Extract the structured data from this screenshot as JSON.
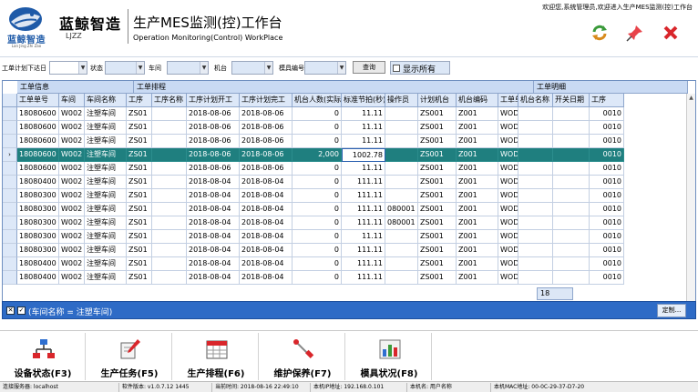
{
  "header": {
    "logo_cn": "蓝鲸智造",
    "logo_en": "Lan Jing Zhi Zao",
    "brand_cn": "蓝鲸智造",
    "brand_en": "LJZZ",
    "title_cn": "生产MES监测(控)工作台",
    "title_en": "Operation Monitoring(Control) WorkPlace",
    "top_status": "欢迎您,系统管理员,欢迎进入生产MES监测(控)工作台",
    "icons": [
      "refresh-icon",
      "pin-icon",
      "close-icon"
    ],
    "colors": {
      "brand": "#1e5aa8",
      "close": "#d9262b",
      "refresh": "#3a9a3a"
    }
  },
  "filters": {
    "f1_label": "工单计划下达日",
    "f2_label": "状态",
    "f3_label": "车间",
    "f4_label": "机台",
    "f5_label": "模具编号",
    "query_label": "查询",
    "show_all_label": "显示所有"
  },
  "grid": {
    "bands": [
      "工单信息",
      "工单排程",
      "工单明细"
    ],
    "columns": [
      "工单单号",
      "车间",
      "车间名称",
      "工序",
      "工序名称",
      "工序计划开工",
      "工序计划完工",
      "机台人数(实际)",
      "标准节拍(秒)",
      "操作员",
      "计划机台",
      "机台编码",
      "工单单号",
      "机台名称",
      "开关日期",
      "工序"
    ],
    "rows": [
      [
        "18080600",
        "W002",
        "注塑车间",
        "ZS01",
        "",
        "2018-08-06",
        "2018-08-06",
        "0",
        "11.11",
        "",
        "ZS001",
        "Z001",
        "WOD",
        "",
        "",
        "0010"
      ],
      [
        "18080600",
        "W002",
        "注塑车间",
        "ZS01",
        "",
        "2018-08-06",
        "2018-08-06",
        "0",
        "11.11",
        "",
        "ZS001",
        "Z001",
        "WOD",
        "",
        "",
        "0010"
      ],
      [
        "18080600",
        "W002",
        "注塑车间",
        "ZS01",
        "",
        "2018-08-06",
        "2018-08-06",
        "0",
        "11.11",
        "",
        "ZS001",
        "Z001",
        "WOD",
        "",
        "",
        "0010"
      ],
      [
        "18080600",
        "W002",
        "注塑车间",
        "ZS01",
        "",
        "2018-08-06",
        "2018-08-06",
        "2,000",
        "1002.78",
        "",
        "ZS001",
        "Z001",
        "WOD",
        "",
        "",
        "0010"
      ],
      [
        "18080600",
        "W002",
        "注塑车间",
        "ZS01",
        "",
        "2018-08-06",
        "2018-08-06",
        "0",
        "11.11",
        "",
        "ZS001",
        "Z001",
        "WOD",
        "",
        "",
        "0010"
      ],
      [
        "18080400",
        "W002",
        "注塑车间",
        "ZS01",
        "",
        "2018-08-04",
        "2018-08-04",
        "0",
        "111.11",
        "",
        "ZS001",
        "Z001",
        "WOD",
        "",
        "",
        "0010"
      ],
      [
        "18080300",
        "W002",
        "注塑车间",
        "ZS01",
        "",
        "2018-08-04",
        "2018-08-04",
        "0",
        "111.11",
        "",
        "ZS001",
        "Z001",
        "WOD",
        "",
        "",
        "0010"
      ],
      [
        "18080300",
        "W002",
        "注塑车间",
        "ZS01",
        "",
        "2018-08-04",
        "2018-08-04",
        "0",
        "111.11",
        "080001",
        "ZS001",
        "Z001",
        "WOD",
        "",
        "",
        "0010"
      ],
      [
        "18080300",
        "W002",
        "注塑车间",
        "ZS01",
        "",
        "2018-08-04",
        "2018-08-04",
        "0",
        "111.11",
        "080001",
        "ZS001",
        "Z001",
        "WOD",
        "",
        "",
        "0010"
      ],
      [
        "18080300",
        "W002",
        "注塑车间",
        "ZS01",
        "",
        "2018-08-04",
        "2018-08-04",
        "0",
        "11.11",
        "",
        "ZS001",
        "Z001",
        "WOD",
        "",
        "",
        "0010"
      ],
      [
        "18080300",
        "W002",
        "注塑车间",
        "ZS01",
        "",
        "2018-08-04",
        "2018-08-04",
        "0",
        "111.11",
        "",
        "ZS001",
        "Z001",
        "WOD",
        "",
        "",
        "0010"
      ],
      [
        "18080400",
        "W002",
        "注塑车间",
        "ZS01",
        "",
        "2018-08-04",
        "2018-08-04",
        "0",
        "111.11",
        "",
        "ZS001",
        "Z001",
        "WOD",
        "",
        "",
        "0010"
      ],
      [
        "18080400",
        "W002",
        "注塑车间",
        "ZS01",
        "",
        "2018-08-04",
        "2018-08-04",
        "0",
        "111.11",
        "",
        "ZS001",
        "Z001",
        "WOD",
        "",
        "",
        "0010"
      ]
    ],
    "selected_row": 3,
    "summary_value": "18"
  },
  "filter_status": {
    "text": "(车间名称 = 注塑车间)",
    "custom_label": "定制..."
  },
  "toolbar": {
    "buttons": [
      {
        "label": "设备状态(F3)",
        "icon": "network-icon"
      },
      {
        "label": "生产任务(F5)",
        "icon": "edit-icon"
      },
      {
        "label": "生产排程(F6)",
        "icon": "calendar-icon"
      },
      {
        "label": "维护保养(F7)",
        "icon": "wrench-icon"
      },
      {
        "label": "模具状况(F8)",
        "icon": "bar-chart-icon"
      }
    ]
  },
  "statusbar": {
    "s1": "连接服务器: localhost",
    "s2": "软件版本: v1.0.7.12 1445",
    "s3": "当前时间: 2018-08-16 22:49:10",
    "s4": "本机IP地址: 192.168.0.101",
    "s5": "本机名: 用户名称",
    "s6": "本机MAC地址: 00-0C-29-37-D7-20"
  }
}
